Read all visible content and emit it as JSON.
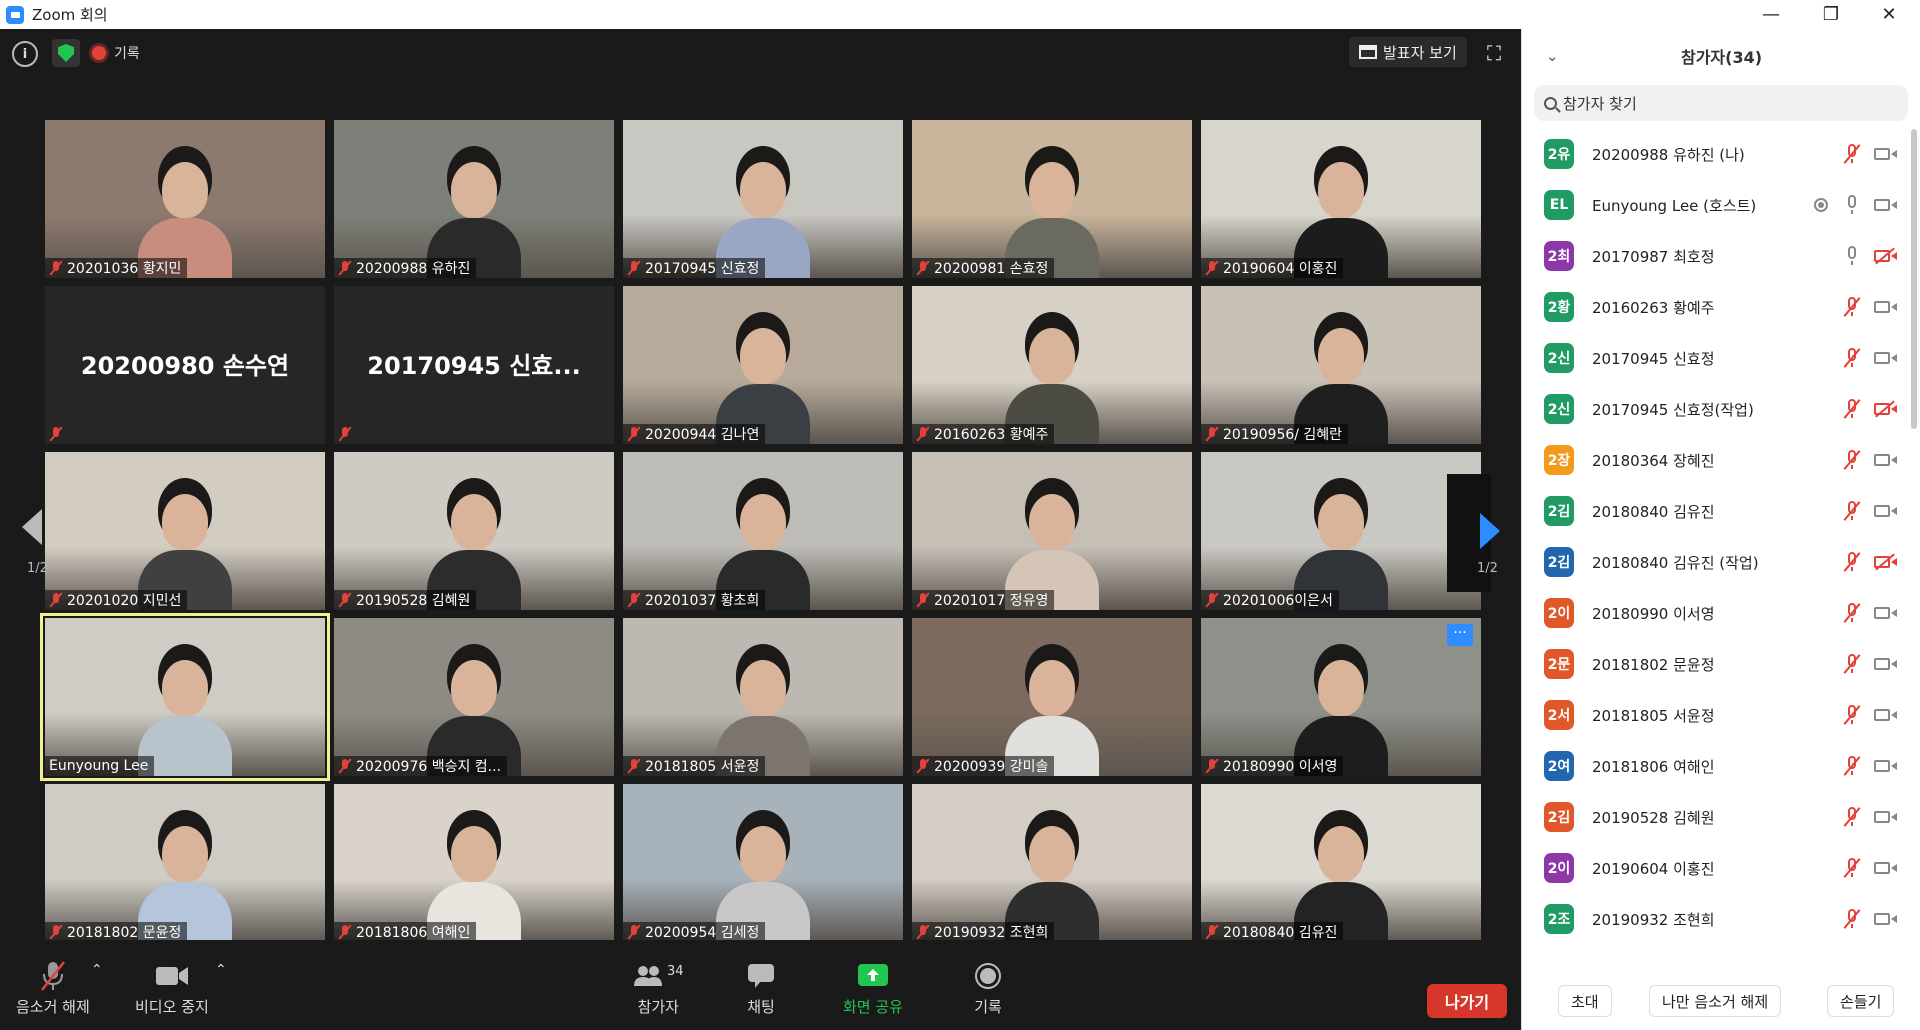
{
  "window": {
    "title": "Zoom 회의",
    "minimize": "—",
    "restore": "❐",
    "close": "✕"
  },
  "topbar": {
    "info": "i",
    "record_label": "기록",
    "view_button": "발표자 보기",
    "fullscreen": "⛶"
  },
  "pager": {
    "left_page": "1/2",
    "right_page": "1/2"
  },
  "tiles": [
    {
      "name": "20201036 황지민",
      "color": "#8d7a6e",
      "body": "#c98d80"
    },
    {
      "name": "20200988 유하진",
      "color": "#7d8078",
      "body": "#2a2a2a"
    },
    {
      "name": "20170945 신효정",
      "color": "#c9c7c2",
      "body": "#9aa7c4"
    },
    {
      "name": "20200981 손효정",
      "color": "#c8b59b",
      "body": "#6a6a60"
    },
    {
      "name": "20190604 이홍진",
      "color": "#d8d5cd",
      "body": "#1c1c1c"
    },
    {
      "name": "",
      "big": "20200980 손수연"
    },
    {
      "name": "",
      "big": "20170945 신효..."
    },
    {
      "name": "20200944 김나연",
      "color": "#b7aa9a",
      "body": "#3a3f44"
    },
    {
      "name": "20160263 황예주",
      "color": "#d7d1c5",
      "body": "#4c4c45"
    },
    {
      "name": "20190956/ 김혜란",
      "color": "#c8c1b6",
      "body": "#1f1f1f"
    },
    {
      "name": "20201020 지민선",
      "color": "#d2ccc1",
      "body": "#404040"
    },
    {
      "name": "20190528 김혜원",
      "color": "#cfcac3",
      "body": "#2c2c2c"
    },
    {
      "name": "20201037 황초희",
      "color": "#bebcb6",
      "body": "#2a2a2a"
    },
    {
      "name": "20201017 정유영",
      "color": "#c6bfb6",
      "body": "#d5c5b6"
    },
    {
      "name": "20201006이은서",
      "color": "#cac8c2",
      "body": "#303438"
    },
    {
      "name": "Eunyoung Lee",
      "color": "#cfcbc5",
      "body": "#b8c3cc",
      "active": true,
      "unmuted": true
    },
    {
      "name": "20200976 백승지 컴...",
      "color": "#8e8a84",
      "body": "#2a2a2a"
    },
    {
      "name": "20181805 서윤정",
      "color": "#bdb9b2",
      "body": "#7b756d"
    },
    {
      "name": "20200939 강미솔",
      "color": "#7b6a5d",
      "body": "#e1dfdc"
    },
    {
      "name": "20180990 이서영",
      "color": "#8d9189",
      "body": "#1d1d1d",
      "more": true
    },
    {
      "name": "20181802 문윤정",
      "color": "#cfccc6",
      "body": "#b5c5dc"
    },
    {
      "name": "20181806 여해인",
      "color": "#d9d3cc",
      "body": "#e8e4de"
    },
    {
      "name": "20200954 김세정",
      "color": "#a7b2bb",
      "body": "#c9c7c8"
    },
    {
      "name": "20190932 조현희",
      "color": "#d3cdc5",
      "body": "#2e2e2e"
    },
    {
      "name": "20180840 김유진",
      "color": "#ddd9d3",
      "body": "#232323"
    }
  ],
  "toolbar": {
    "mute": "음소거 해제",
    "video": "비디오 중지",
    "participants": "참가자",
    "participants_count": "34",
    "chat": "채팅",
    "share": "화면 공유",
    "record": "기록",
    "leave": "나가기",
    "caret": "⌃"
  },
  "panel": {
    "title": "참가자(34)",
    "collapse": "⌄",
    "search_placeholder": "참가자 찾기",
    "participants": [
      {
        "avatar": "2유",
        "color": "#1f9b63",
        "name": "20200988 유하진 (나)",
        "mic": "muted",
        "cam": "on"
      },
      {
        "avatar": "EL",
        "color": "#1f9b63",
        "name": "Eunyoung Lee (호스트)",
        "mic": "on",
        "cam": "on",
        "share": true
      },
      {
        "avatar": "2최",
        "color": "#8d38a8",
        "name": "20170987 최호정",
        "mic": "on",
        "cam": "off"
      },
      {
        "avatar": "2황",
        "color": "#1f9b63",
        "name": "20160263 황예주",
        "mic": "muted",
        "cam": "on"
      },
      {
        "avatar": "2신",
        "color": "#1f9b63",
        "name": "20170945 신효정",
        "mic": "muted",
        "cam": "on"
      },
      {
        "avatar": "2신",
        "color": "#1f9b63",
        "name": "20170945 신효정(작업)",
        "mic": "muted",
        "cam": "off"
      },
      {
        "avatar": "2장",
        "color": "#f39a1c",
        "name": "20180364 장혜진",
        "mic": "muted",
        "cam": "on"
      },
      {
        "avatar": "2김",
        "color": "#1f9b63",
        "name": "20180840 김유진",
        "mic": "muted",
        "cam": "on"
      },
      {
        "avatar": "2김",
        "color": "#2266b0",
        "name": "20180840 김유진 (작업)",
        "mic": "muted",
        "cam": "off"
      },
      {
        "avatar": "2이",
        "color": "#e0582a",
        "name": "20180990 이서영",
        "mic": "muted",
        "cam": "on"
      },
      {
        "avatar": "2문",
        "color": "#e0582a",
        "name": "20181802 문윤정",
        "mic": "muted",
        "cam": "on"
      },
      {
        "avatar": "2서",
        "color": "#e0582a",
        "name": "20181805 서윤정",
        "mic": "muted",
        "cam": "on"
      },
      {
        "avatar": "2여",
        "color": "#2266b0",
        "name": "20181806 여해인",
        "mic": "muted",
        "cam": "on"
      },
      {
        "avatar": "2김",
        "color": "#e0582a",
        "name": "20190528 김혜원",
        "mic": "muted",
        "cam": "on"
      },
      {
        "avatar": "2이",
        "color": "#8d38a8",
        "name": "20190604 이홍진",
        "mic": "muted",
        "cam": "on"
      },
      {
        "avatar": "2조",
        "color": "#1f9b63",
        "name": "20190932 조현희",
        "mic": "muted",
        "cam": "on"
      }
    ],
    "footer": {
      "invite": "초대",
      "unmute_me": "나만 음소거 해제",
      "raise_hand": "손들기"
    }
  }
}
